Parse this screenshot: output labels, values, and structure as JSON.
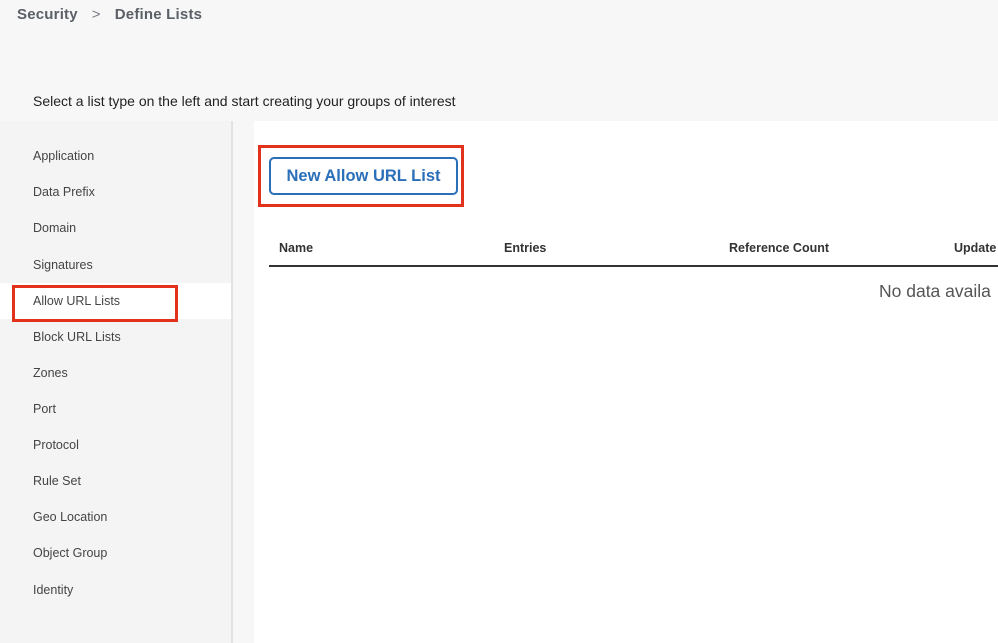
{
  "breadcrumb": {
    "items": [
      "Security",
      "Define Lists"
    ],
    "separator": ">"
  },
  "instruction": "Select a list type on the left and start creating your groups of interest",
  "sidebar": {
    "items": [
      {
        "label": "Application"
      },
      {
        "label": "Data Prefix"
      },
      {
        "label": "Domain"
      },
      {
        "label": "Signatures"
      },
      {
        "label": "Allow URL Lists",
        "active": true
      },
      {
        "label": "Block URL Lists"
      },
      {
        "label": "Zones"
      },
      {
        "label": "Port"
      },
      {
        "label": "Protocol"
      },
      {
        "label": "Rule Set"
      },
      {
        "label": "Geo Location"
      },
      {
        "label": "Object Group"
      },
      {
        "label": "Identity"
      }
    ]
  },
  "main": {
    "new_button_label": "New Allow URL List",
    "table": {
      "columns": [
        "Name",
        "Entries",
        "Reference Count",
        "Update"
      ],
      "empty_text": "No data availa"
    }
  },
  "colors": {
    "accent": "#2a6fb8",
    "highlight": "#e2321c"
  }
}
